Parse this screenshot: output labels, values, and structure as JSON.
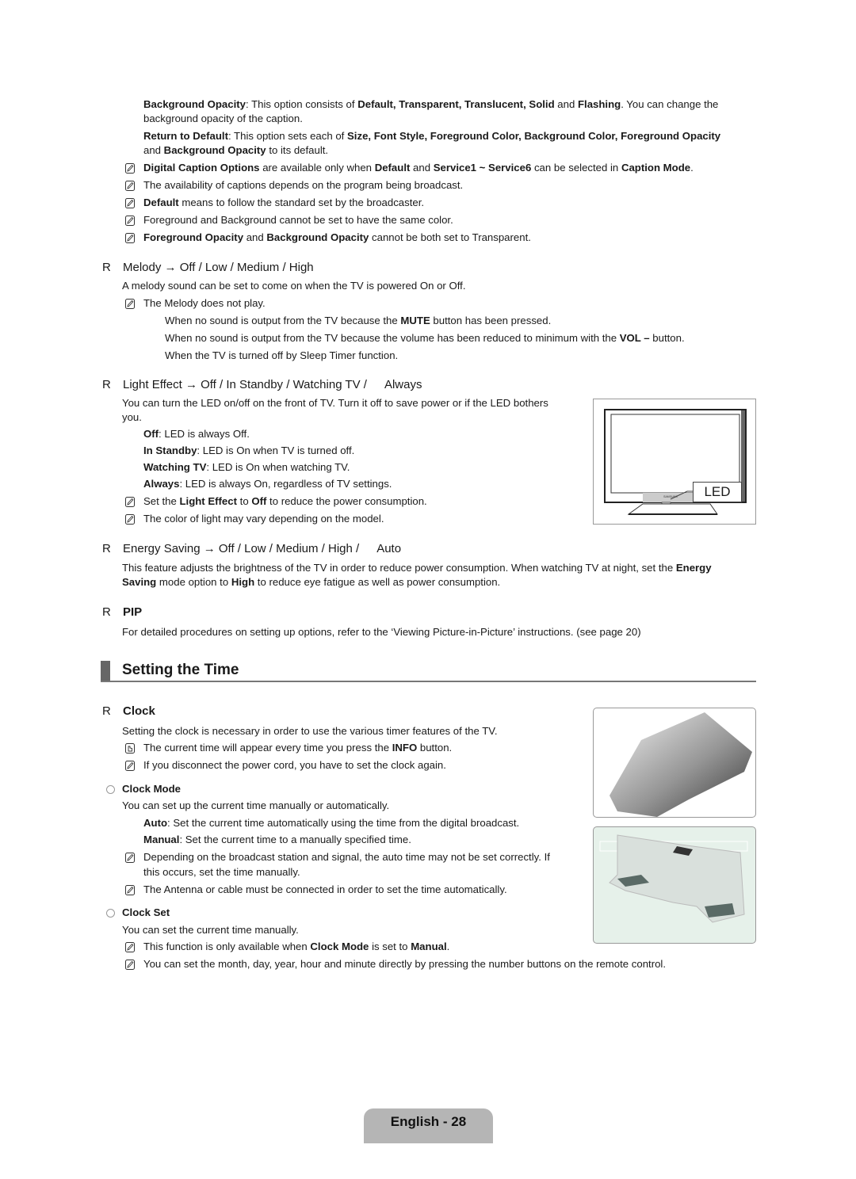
{
  "top_block": {
    "background_opacity": {
      "label": "Background Opacity",
      "text_1": ": This option consists of ",
      "opt1": "Default, Transparent, Translucent, Solid",
      "and": " and ",
      "opt2": "Flashing",
      "text_2": ". You can change the",
      "line2": "background opacity of the caption."
    },
    "return_to_default": {
      "label": "Return to Default",
      "text_1": ": This option sets each of ",
      "opts": "Size, Font Style, Foreground Color, Background Color, Foreground Opacity",
      "line2_pre": "and ",
      "line2_bold": "Background Opacity",
      "line2_post": " to its default."
    },
    "notes": [
      {
        "b1": "Digital Caption Options",
        "t1": " are available only when ",
        "b2": "Default",
        "t2": " and ",
        "b3": "Service1 ~ Service6",
        "t3": " can be selected in ",
        "b4": "Caption Mode",
        "t4": "."
      },
      {
        "t1": "The availability of captions depends on the program being broadcast."
      },
      {
        "b1": "Default",
        "t1": " means to follow the standard set by the broadcaster."
      },
      {
        "t1": "Foreground and Background cannot be set to have the same color."
      },
      {
        "b1": "Foreground Opacity",
        "t1": " and ",
        "b2": "Background Opacity",
        "t2": " cannot be both set to Transparent."
      }
    ]
  },
  "melody": {
    "bullet": "R",
    "heading": "Melody → Off / Low / Medium / High",
    "desc": "A melody sound can be set to come on when the TV is powered On or Off.",
    "note": "The Melody does not play.",
    "sub1_pre": "When no sound is output from the TV because the ",
    "sub1_bold": "MUTE",
    "sub1_post": " button has been pressed.",
    "sub2_pre": "When no sound is output from the TV because the volume has been reduced to minimum with the ",
    "sub2_bold": "VOL –",
    "sub2_post": " button.",
    "sub3": "When the TV is turned off by Sleep Timer function."
  },
  "light_effect": {
    "bullet": "R",
    "heading": "Light Effect → Off / In Standby / Watching TV /",
    "heading_tail": "Always",
    "desc_line1": "You can turn the LED on/off on the front of TV. Turn it off to save power or if the LED bothers",
    "desc_line2": "you.",
    "options": [
      {
        "label": "Off",
        "text": ": LED is always Off."
      },
      {
        "label": "In Standby",
        "text": ": LED is On when TV is turned off."
      },
      {
        "label": "Watching TV",
        "text": ": LED is On when watching TV."
      },
      {
        "label": "Always",
        "text": ": LED is always On, regardless of TV settings."
      }
    ],
    "note1_pre": "Set the ",
    "note1_b1": "Light Effect",
    "note1_mid": " to ",
    "note1_b2": "Off",
    "note1_post": " to reduce the power consumption.",
    "note2": "The color of light may vary depending on the model.",
    "figure": {
      "led_label": "LED",
      "brand": "SAMSUNG"
    }
  },
  "energy_saving": {
    "bullet": "R",
    "heading": "Energy Saving → Off / Low / Medium / High /",
    "heading_tail": "Auto",
    "line1_pre": "This feature adjusts the brightness of the TV in order to reduce power consumption. When watching TV at night, set the ",
    "line1_bold": "Energy",
    "line2_bold1": "Saving",
    "line2_mid": " mode option to ",
    "line2_bold2": "High",
    "line2_post": " to reduce eye fatigue as well as power consumption."
  },
  "pip": {
    "bullet": "R",
    "heading": "PIP",
    "desc": "For detailed procedures on setting up options, refer to the ‘Viewing Picture-in-Picture’ instructions. (see page 20)"
  },
  "section": {
    "title": "Setting the Time"
  },
  "clock": {
    "bullet": "R",
    "heading": "Clock",
    "desc": "Setting the clock is necessary in order to use the various timer features of the TV.",
    "note_info_pre": "The current time will appear every time you press the ",
    "note_info_bold": "INFO",
    "note_info_post": " button.",
    "note_power": "If you disconnect the power cord, you have to set the clock again.",
    "clock_mode": {
      "heading": "Clock Mode",
      "desc": "You can set up the current time manually or automatically.",
      "auto_label": "Auto",
      "auto_text": ": Set the current time automatically using the time from the digital broadcast.",
      "manual_label": "Manual",
      "manual_text": ": Set the current time to a manually specified time.",
      "note1_line1": "Depending on the broadcast station and signal, the auto time may not be set correctly. If",
      "note1_line2": "this occurs, set the time manually.",
      "note2": "The Antenna or cable must be connected in order to set the time automatically."
    },
    "clock_set": {
      "heading": "Clock Set",
      "desc": "You can set the current time manually.",
      "note1_pre": "This function is only available when ",
      "note1_b1": "Clock Mode",
      "note1_mid": " is set to ",
      "note1_b2": "Manual",
      "note1_post": ".",
      "note2": "You can set the month, day, year, hour and minute directly by pressing the number buttons on the remote control."
    }
  },
  "footer": {
    "label": "English - 28"
  },
  "icons": {
    "note": "pencil-note-icon",
    "remote": "remote-button-icon",
    "bullet": "circle-bullet-icon"
  }
}
